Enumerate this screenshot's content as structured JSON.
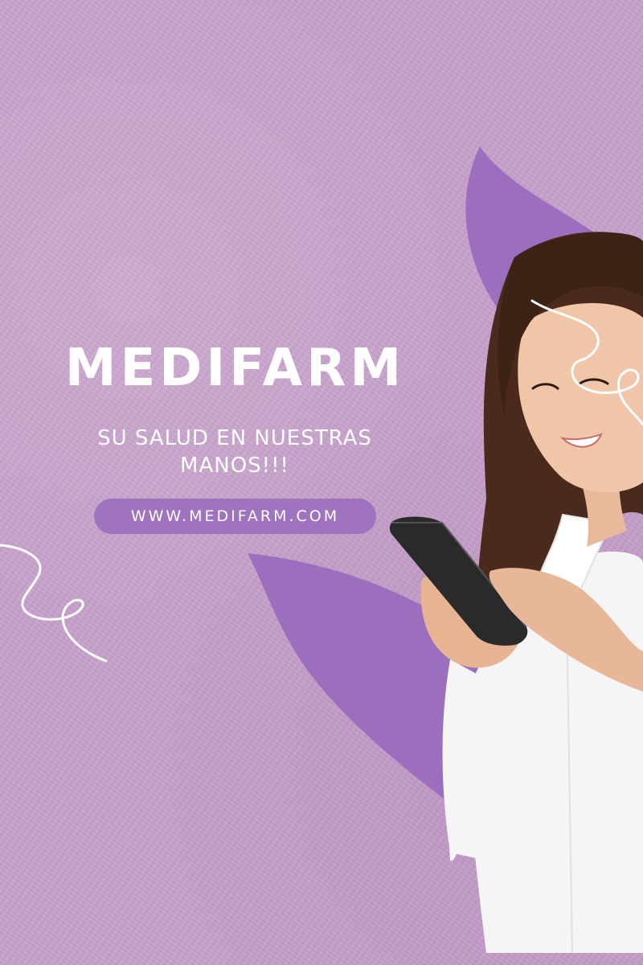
{
  "brand": {
    "name": "MEDIFARM"
  },
  "tagline": "SU SALUD EN NUESTRAS MANOS!!!",
  "website": {
    "label": "WWW.MEDIFARM.COM"
  },
  "colors": {
    "background": "#c8a2cc",
    "leaf": "#9b6fbd",
    "pill": "#9f73bf",
    "text": "#ffffff"
  },
  "photo": {
    "subject": "smiling woman in white shirt using a smartphone"
  }
}
